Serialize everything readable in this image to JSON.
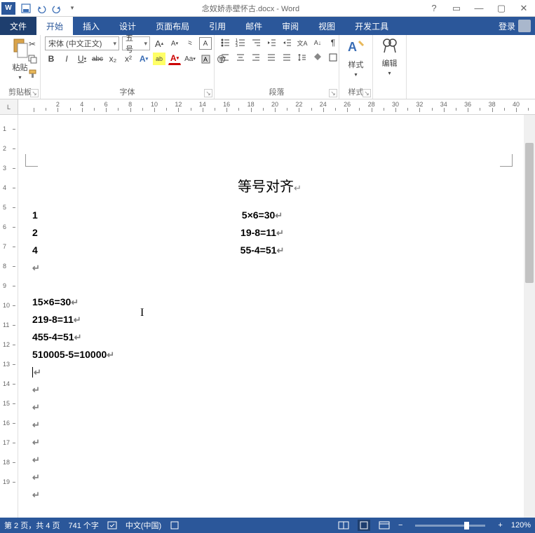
{
  "titlebar": {
    "title": "念奴娇赤壁怀古.docx - Word",
    "help": "?",
    "ribbon_opts": "▭",
    "min": "—",
    "max": "▢",
    "close": "✕"
  },
  "tabs": {
    "file": "文件",
    "items": [
      "开始",
      "插入",
      "设计",
      "页面布局",
      "引用",
      "邮件",
      "审阅",
      "视图",
      "开发工具"
    ],
    "active_index": 0,
    "login": "登录"
  },
  "ribbon": {
    "clipboard": {
      "paste": "粘贴",
      "label": "剪贴板"
    },
    "font": {
      "name": "宋体 (中文正文)",
      "size": "五号",
      "grow": "A",
      "shrink": "A",
      "clear": "Aa",
      "phon": "⺀",
      "box": "A",
      "bold": "B",
      "italic": "I",
      "underline": "U",
      "strike": "abc",
      "sub": "x₂",
      "sup": "x²",
      "effects": "A",
      "highlight": "ab",
      "color": "A",
      "label": "字体"
    },
    "para": {
      "label": "段落"
    },
    "styles": {
      "btn": "样式",
      "label": "样式"
    },
    "edit": {
      "btn": "编辑"
    }
  },
  "ruler": {
    "left_btn": "L",
    "marks": [
      2,
      4,
      6,
      8,
      10,
      12,
      14,
      16,
      18,
      20,
      22,
      24,
      26,
      28,
      30,
      32,
      34,
      36,
      38,
      40
    ]
  },
  "vruler": {
    "marks": [
      1,
      2,
      3,
      4,
      5,
      6,
      7,
      8,
      9,
      10,
      11,
      12,
      13,
      14,
      15,
      16,
      17,
      18,
      19
    ]
  },
  "document": {
    "title": "等号对齐",
    "block1_nums": [
      "1",
      "2",
      "4"
    ],
    "block1_eqs": [
      "5×6=30",
      "19-8=11",
      "55-4=51"
    ],
    "block2": [
      "15×6=30",
      "219-8=11",
      "455-4=51",
      "510005-5=10000"
    ]
  },
  "statusbar": {
    "page": "第 2 页，共 4 页",
    "words": "741 个字",
    "lang": "中文(中国)",
    "zoom": "120%"
  }
}
